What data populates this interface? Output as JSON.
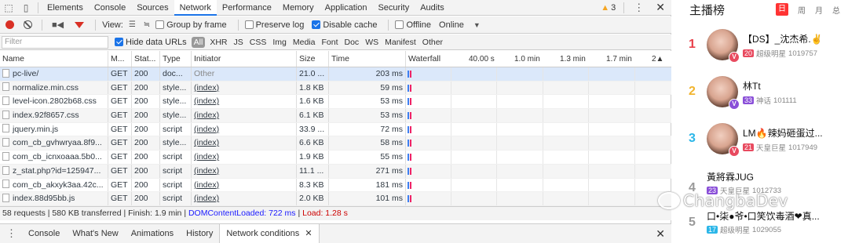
{
  "devtools": {
    "tabs": [
      "Elements",
      "Console",
      "Sources",
      "Network",
      "Performance",
      "Memory",
      "Application",
      "Security",
      "Audits"
    ],
    "active_tab": "Network",
    "warning_count": "3",
    "toolbar": {
      "view_label": "View:",
      "group_by_frame": "Group by frame",
      "preserve_log": "Preserve log",
      "disable_cache": "Disable cache",
      "offline": "Offline",
      "throttle": "Online"
    },
    "filter": {
      "placeholder": "Filter",
      "hide_data_urls": "Hide data URLs",
      "types": [
        "All",
        "XHR",
        "JS",
        "CSS",
        "Img",
        "Media",
        "Font",
        "Doc",
        "WS",
        "Manifest",
        "Other"
      ]
    },
    "columns": [
      "Name",
      "M...",
      "Stat...",
      "Type",
      "Initiator",
      "Size",
      "Time",
      "Waterfall"
    ],
    "waterfall_ticks": [
      "40.00 s",
      "1.0 min",
      "1.3 min",
      "1.7 min",
      "2▲"
    ],
    "rows": [
      {
        "name": "pc-live/",
        "method": "GET",
        "status": "200",
        "type": "doc...",
        "initiator": "Other",
        "size": "21.0 ...",
        "time": "203 ms"
      },
      {
        "name": "normalize.min.css",
        "method": "GET",
        "status": "200",
        "type": "style...",
        "initiator": "(index)",
        "size": "1.8 KB",
        "time": "59 ms"
      },
      {
        "name": "level-icon.2802b68.css",
        "method": "GET",
        "status": "200",
        "type": "style...",
        "initiator": "(index)",
        "size": "1.6 KB",
        "time": "53 ms"
      },
      {
        "name": "index.92f8657.css",
        "method": "GET",
        "status": "200",
        "type": "style...",
        "initiator": "(index)",
        "size": "6.1 KB",
        "time": "53 ms"
      },
      {
        "name": "jquery.min.js",
        "method": "GET",
        "status": "200",
        "type": "script",
        "initiator": "(index)",
        "size": "33.9 ...",
        "time": "72 ms"
      },
      {
        "name": "com_cb_gvhwryaa.8f9...",
        "method": "GET",
        "status": "200",
        "type": "style...",
        "initiator": "(index)",
        "size": "6.6 KB",
        "time": "58 ms"
      },
      {
        "name": "com_cb_icnxoaaa.5b0...",
        "method": "GET",
        "status": "200",
        "type": "script",
        "initiator": "(index)",
        "size": "1.9 KB",
        "time": "55 ms"
      },
      {
        "name": "z_stat.php?id=125947...",
        "method": "GET",
        "status": "200",
        "type": "script",
        "initiator": "(index)",
        "size": "11.1 ...",
        "time": "271 ms"
      },
      {
        "name": "com_cb_akxyk3aa.42c...",
        "method": "GET",
        "status": "200",
        "type": "script",
        "initiator": "(index)",
        "size": "8.3 KB",
        "time": "181 ms"
      },
      {
        "name": "index.88d95bb.js",
        "method": "GET",
        "status": "200",
        "type": "script",
        "initiator": "(index)",
        "size": "2.0 KB",
        "time": "101 ms"
      }
    ],
    "status": {
      "summary": "58 requests | 580 KB transferred | Finish: 1.9 min | ",
      "dcl": "DOMContentLoaded: 722 ms",
      "sep": " | ",
      "load": "Load: 1.28 s"
    },
    "drawer_tabs": [
      "Console",
      "What's New",
      "Animations",
      "History",
      "Network conditions"
    ]
  },
  "ranking": {
    "title": "主播榜",
    "tabs": [
      "日",
      "周",
      "月",
      "总"
    ],
    "entries": [
      {
        "rank": "1",
        "name": "【DS】_沈杰希.✌",
        "level": "20",
        "title": "超级明星",
        "score": "1019757",
        "rank_color": "#e8414b",
        "badge_color": "#e84a5f"
      },
      {
        "rank": "2",
        "name": "林Tt",
        "level": "33",
        "title": "神话",
        "score": "101111",
        "rank_color": "#f1b42f",
        "badge_color": "#8a4fd8"
      },
      {
        "rank": "3",
        "name": "LM🔥辣妈砸蛋过...",
        "level": "21",
        "title": "天皇巨星",
        "score": "1017949",
        "rank_color": "#2bb6e8",
        "badge_color": "#e84a5f"
      },
      {
        "rank": "4",
        "name": "黃將霖JUG",
        "level": "23",
        "title": "天皇巨星",
        "score": "1012733",
        "rank_color": "#999999",
        "badge_color": "#8a4fd8"
      },
      {
        "rank": "5",
        "name": "口•柒●爷•口笑饮毒酒❤真...",
        "level": "17",
        "title": "超级明星",
        "score": "1029055",
        "rank_color": "#999999",
        "badge_color": "#2bb6e8"
      }
    ],
    "watermark": "ChangbaDev"
  }
}
